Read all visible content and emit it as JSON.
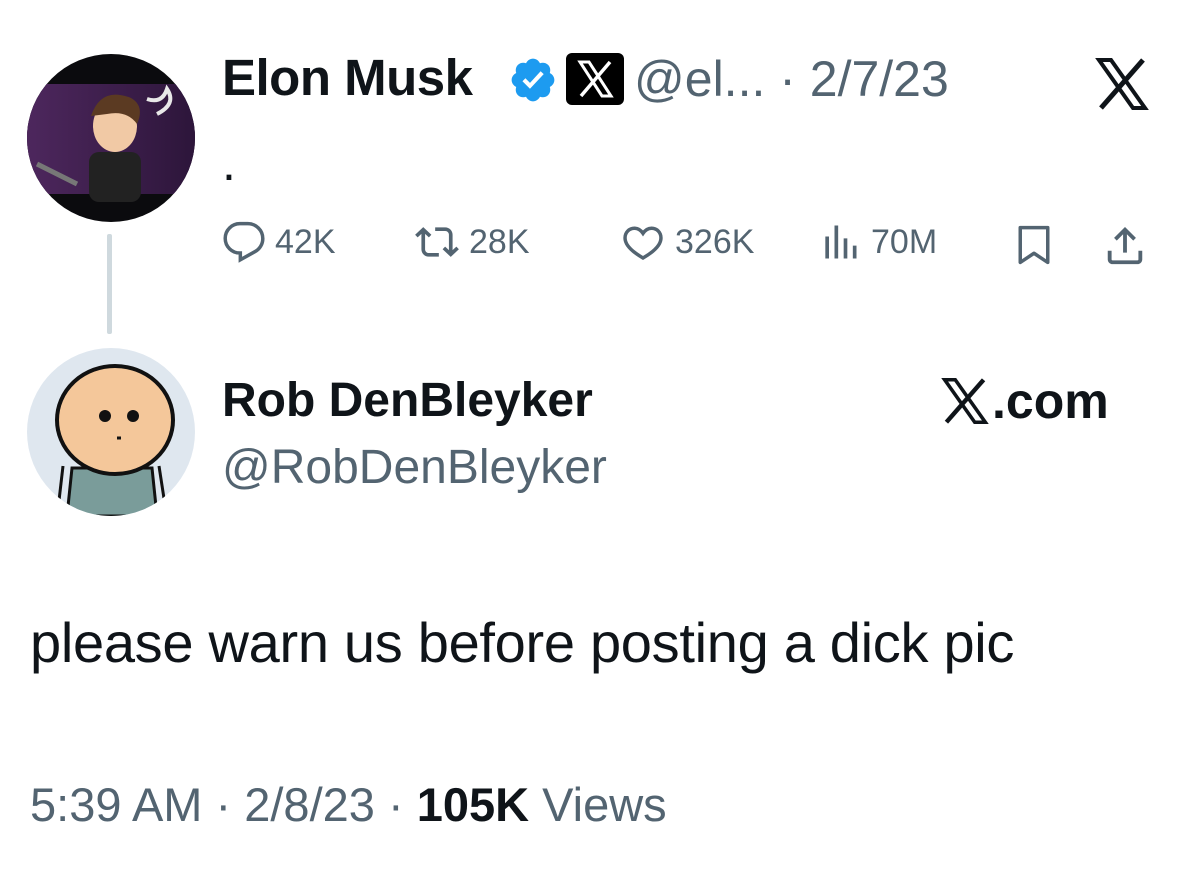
{
  "parent_tweet": {
    "author_name": "Elon Musk",
    "handle_date": "@el... · 2/7/23",
    "text": ".",
    "metrics": {
      "replies": "42K",
      "retweets": "28K",
      "likes": "326K",
      "views": "70M"
    }
  },
  "reply": {
    "author_name": "Rob DenBleyker",
    "handle": "@RobDenBleyker",
    "source": ".com",
    "text": "please warn us before posting a dick pic",
    "time": "5:39 AM",
    "date": "2/8/23",
    "views_count": "105K",
    "views_label": "Views"
  },
  "colors": {
    "text": "#0f1419",
    "secondary": "#536471",
    "verified": "#1d9bf0",
    "thread_line": "#cfd9de"
  },
  "icons": [
    "verified-badge-icon",
    "x-affiliate-badge-icon",
    "x-logo-icon",
    "reply-icon",
    "retweet-icon",
    "like-icon",
    "views-icon",
    "bookmark-icon",
    "share-icon"
  ]
}
